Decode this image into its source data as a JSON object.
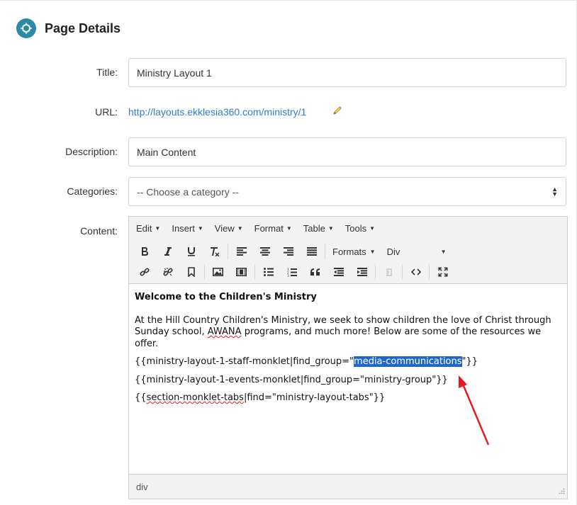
{
  "section": {
    "title": "Page Details",
    "icon": "crosshair-icon",
    "accent": "#2a8ba4"
  },
  "form": {
    "title_label": "Title:",
    "title_value": "Ministry Layout 1",
    "url_label": "URL:",
    "url_value": "http://layouts.ekklesia360.com/ministry/1",
    "description_label": "Description:",
    "description_value": "Main Content",
    "categories_label": "Categories:",
    "categories_value": "-- Choose a category --",
    "content_label": "Content:"
  },
  "editor": {
    "menus": [
      "Edit",
      "Insert",
      "View",
      "Format",
      "Table",
      "Tools"
    ],
    "formats_label": "Formats",
    "block_format": "Div",
    "content": {
      "heading": "Welcome to the Children's Ministry",
      "para_start": "At the Hill Country Children's Ministry, we seek to show children the love of Christ through Sunday school, ",
      "para_awana": "AWANA",
      "para_end": " programs, and much more! Below are some of the resources we offer.",
      "line1_prefix": "{{ministry-layout-1-staff-monklet|find_group=\"",
      "line1_selected": "media-communications",
      "line1_suffix": "\"}}",
      "line2": "{{ministry-layout-1-events-monklet|find_group=\"ministry-group\"}}",
      "line3_prefix": "{{",
      "line3_squiggle": "section-monklet-tabs",
      "line3_suffix": "|find=\"ministry-layout-tabs\"}}"
    },
    "status_path": "div"
  },
  "annotation": {
    "arrow_color": "#e8161d"
  },
  "colors": {
    "link": "#2b7cd0",
    "selection": "#1f68c9"
  }
}
